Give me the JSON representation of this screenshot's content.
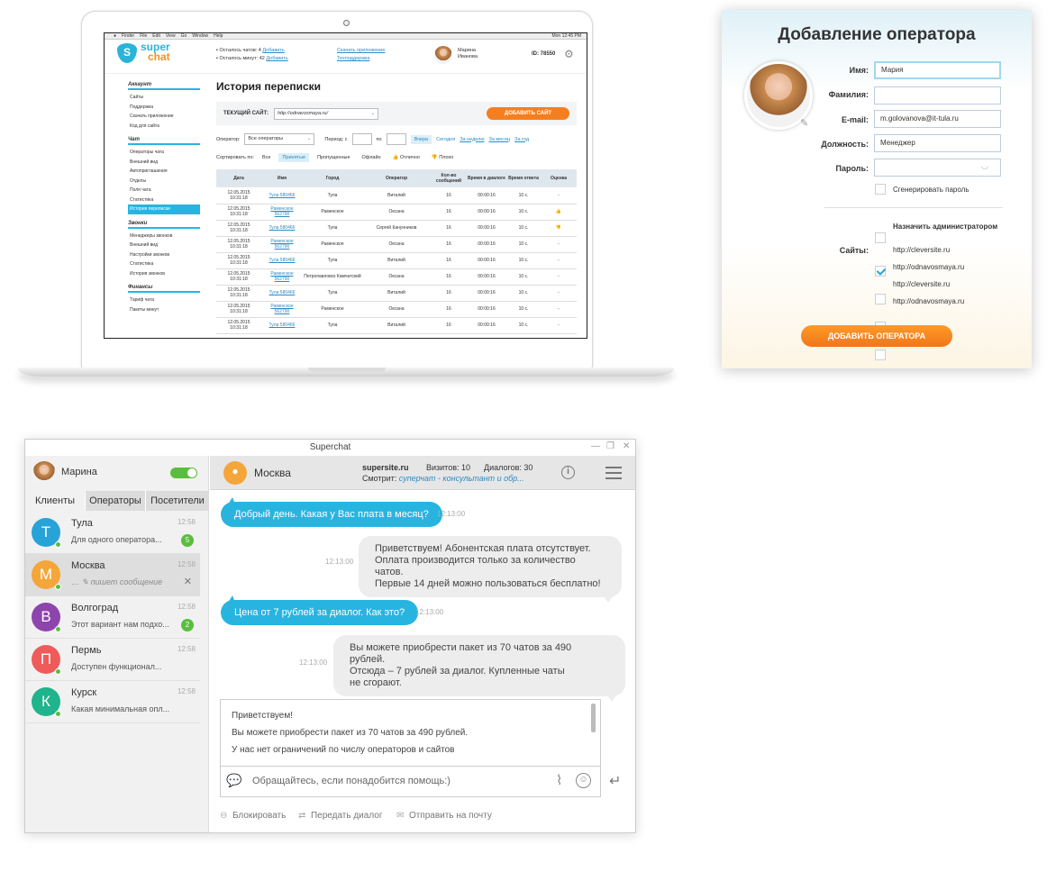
{
  "laptop": {
    "menubar": {
      "items": [
        "Finder",
        "File",
        "Edit",
        "View",
        "Go",
        "Window",
        "Help"
      ],
      "time": "Mon 12:45 PM"
    },
    "header": {
      "logo": {
        "letter": "S",
        "line1": "super",
        "line2": "chat"
      },
      "chats_left": "Осталось чатов: 4",
      "minutes_left": "Осталось минут: 42",
      "buy_label": "Добавить",
      "download_app": "Скачать приложение",
      "support": "Техподдержка",
      "user_first": "Марина",
      "user_last": "Иванова",
      "user_id": "ID: 78550"
    },
    "sidebar": {
      "sections": [
        {
          "title": "Аккаунт",
          "items": [
            "Сайты",
            "Поддержка",
            "Скачать приложение",
            "Код для сайта"
          ]
        },
        {
          "title": "Чат",
          "items": [
            "Операторы чата",
            "Внешний вид",
            "Автоприглашения",
            "Отделы",
            "Поля чата",
            "Статистика",
            "История переписки"
          ]
        },
        {
          "title": "Звонки",
          "items": [
            "Менеджеры звонков",
            "Внешний вид",
            "Настройки звонков",
            "Статистика",
            "История звонков"
          ]
        },
        {
          "title": "Финансы",
          "items": [
            "Тариф чата",
            "Пакеты минут"
          ]
        }
      ]
    },
    "main": {
      "title": "История переписки",
      "current_site_label": "ТЕКУЩИЙ САЙТ:",
      "current_site": "http://odnavosmaya.ru/",
      "add_site": "ДОБАВИТЬ САЙТ",
      "operator_label": "Оператор:",
      "operator_value": "Все операторы",
      "period_label": "Период: с",
      "period_to": "по",
      "quick_periods": [
        "Вчера",
        "Сегодня",
        "За неделю",
        "За месяц",
        "За год"
      ],
      "sort_label": "Сортировать по:",
      "sort_opts": [
        "Все",
        "Принятые",
        "Пропущенные",
        "Офлайн",
        "Отлично",
        "Плохо"
      ],
      "columns": [
        "Дата",
        "Имя",
        "Город",
        "Оператор",
        "Кол-во сообщений",
        "Время в диалоге",
        "Время ответа",
        "Оценка"
      ],
      "rows": [
        {
          "date1": "12.05.2015",
          "date2": "10:31:18",
          "name1": "Тула 580466",
          "name2": "",
          "city": "Тула",
          "op": "Виталий",
          "n": "16",
          "dur": "00:00:16",
          "resp": "10 с.",
          "rate": "-"
        },
        {
          "date1": "12.05.2015",
          "date2": "10:31:18",
          "name1": "Раменское",
          "name2": "562790",
          "city": "Раменское",
          "op": "Оксана",
          "n": "16",
          "dur": "00:00:16",
          "resp": "10 с.",
          "rate": "good"
        },
        {
          "date1": "12.05.2015",
          "date2": "10:31:18",
          "name1": "Тула 580466",
          "name2": "",
          "city": "Тула",
          "op": "Сергей Канунников",
          "n": "16",
          "dur": "00:00:16",
          "resp": "10 с.",
          "rate": "bad"
        },
        {
          "date1": "12.05.2015",
          "date2": "10:31:18",
          "name1": "Раменское",
          "name2": "562790",
          "city": "Раменское",
          "op": "Оксана",
          "n": "16",
          "dur": "00:00:16",
          "resp": "10 с.",
          "rate": "-"
        },
        {
          "date1": "12.05.2015",
          "date2": "10:31:18",
          "name1": "Тула 580466",
          "name2": "",
          "city": "Тула",
          "op": "Виталий",
          "n": "16",
          "dur": "00:00:16",
          "resp": "10 с.",
          "rate": "-"
        },
        {
          "date1": "12.05.2015",
          "date2": "10:31:18",
          "name1": "Раменское",
          "name2": "562790",
          "city": "Петропавловск Камчатский",
          "op": "Оксана",
          "n": "16",
          "dur": "00:00:16",
          "resp": "10 с.",
          "rate": "-"
        },
        {
          "date1": "12.05.2015",
          "date2": "10:31:18",
          "name1": "Тула 580466",
          "name2": "",
          "city": "Тула",
          "op": "Виталий",
          "n": "16",
          "dur": "00:00:16",
          "resp": "10 с.",
          "rate": "-"
        },
        {
          "date1": "12.05.2015",
          "date2": "10:31:18",
          "name1": "Раменское",
          "name2": "562790",
          "city": "Раменское",
          "op": "Оксана",
          "n": "16",
          "dur": "00:00:16",
          "resp": "10 с.",
          "rate": "-"
        },
        {
          "date1": "12.05.2015",
          "date2": "10:31:18",
          "name1": "Тула 580466",
          "name2": "",
          "city": "Тула",
          "op": "Виталий",
          "n": "16",
          "dur": "00:00:16",
          "resp": "10 с.",
          "rate": "-"
        }
      ]
    }
  },
  "add_operator": {
    "title": "Добавление оператора",
    "fields": {
      "first_name": {
        "label": "Имя:",
        "value": "Мария"
      },
      "last_name": {
        "label": "Фамилия:",
        "value": ""
      },
      "email": {
        "label": "E-mail:",
        "value": "m.golovanova@it-tula.ru"
      },
      "position": {
        "label": "Должность:",
        "value": "Менеджер"
      },
      "password": {
        "label": "Пароль:",
        "value": ""
      }
    },
    "generate_password": "Сгенерировать пароль",
    "make_admin": "Назначить администратором",
    "sites_label": "Сайты:",
    "sites": [
      {
        "url": "http://cleversite.ru",
        "checked": true
      },
      {
        "url": "http://odnavosmaya.ru",
        "checked": false
      },
      {
        "url": "http://cleversite.ru",
        "checked": false
      },
      {
        "url": "http://odnavosmaya.ru",
        "checked": false
      }
    ],
    "submit": "ДОБАВИТЬ ОПЕРАТОРА"
  },
  "chat_app": {
    "window_title": "Superchat",
    "me": "Марина",
    "tabs": [
      "Клиенты",
      "Операторы",
      "Посетители"
    ],
    "clients": [
      {
        "letter": "Т",
        "name": "Тула",
        "time": "12:58",
        "preview": "Для одного оператора...",
        "badge": "5",
        "color": "#27a3d8"
      },
      {
        "letter": "М",
        "name": "Москва",
        "time": "12:58",
        "preview": "пишет сообщение",
        "badge": "",
        "color": "#f4a63a"
      },
      {
        "letter": "В",
        "name": "Волгоград",
        "time": "12:58",
        "preview": "Этот вариант нам подхо...",
        "badge": "2",
        "color": "#8e44ad"
      },
      {
        "letter": "П",
        "name": "Пермь",
        "time": "12:58",
        "preview": "Доступен функционал...",
        "badge": "",
        "color": "#ef5a5a"
      },
      {
        "letter": "К",
        "name": "Курск",
        "time": "12:58",
        "preview": "Какая минимальная опл...",
        "badge": "",
        "color": "#1fb48c"
      }
    ],
    "header": {
      "city": "Москва",
      "site": "supersite.ru",
      "visits": "Визитов: 10",
      "dialogs": "Диалогов: 30",
      "watching_label": "Смотрит:",
      "watching_page": "суперчат - консультант и обр..."
    },
    "messages": [
      {
        "dir": "in",
        "text": "Добрый день. Какая у Вас плата в месяц?",
        "time": "12:13:00"
      },
      {
        "dir": "out",
        "lines": [
          "Приветствуем! Абонентская плата отсутствует.",
          "Оплата производится только за количество чатов.",
          "Первые 14 дней можно пользоваться бесплатно!"
        ],
        "time": "12:13:00"
      },
      {
        "dir": "in",
        "text": "Цена от 7 рублей за диалог. Как это?",
        "time": "12:13:00"
      },
      {
        "dir": "out",
        "lines": [
          "Вы можете приобрести пакет из 70 чатов за 490 рублей.",
          "Отсюда – 7 рублей за диалог. Купленные чаты",
          "не сгорают."
        ],
        "time": "12:13:00"
      }
    ],
    "templates": [
      "Приветствуем!",
      "Вы можете приобрести пакет из 70 чатов за 490 рублей.",
      "У нас нет ограничений по числу операторов и сайтов"
    ],
    "input_placeholder": "Обращайтесь, если понадобится помощь:)",
    "actions": {
      "block": "Блокировать",
      "transfer": "Передать диалог",
      "email": "Отправить на почту"
    }
  }
}
